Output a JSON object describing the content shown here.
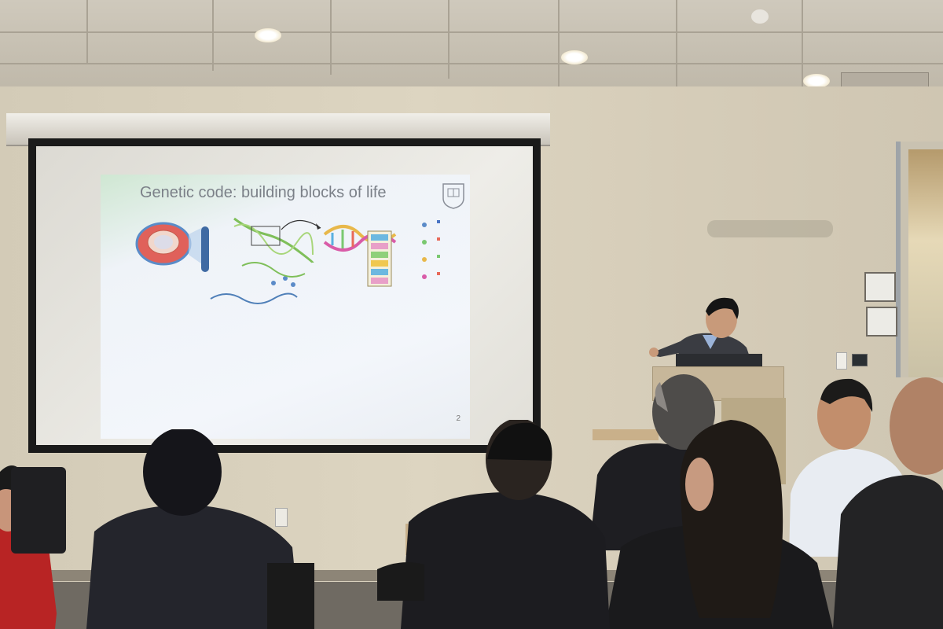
{
  "slide": {
    "title": "Genetic code: building blocks of life",
    "page_number": "2"
  },
  "colors": {
    "wall": "#d8d0bd",
    "screen_frame": "#1a1a1a",
    "slide_title": "#7b8088",
    "podium": "#c7b79a"
  }
}
